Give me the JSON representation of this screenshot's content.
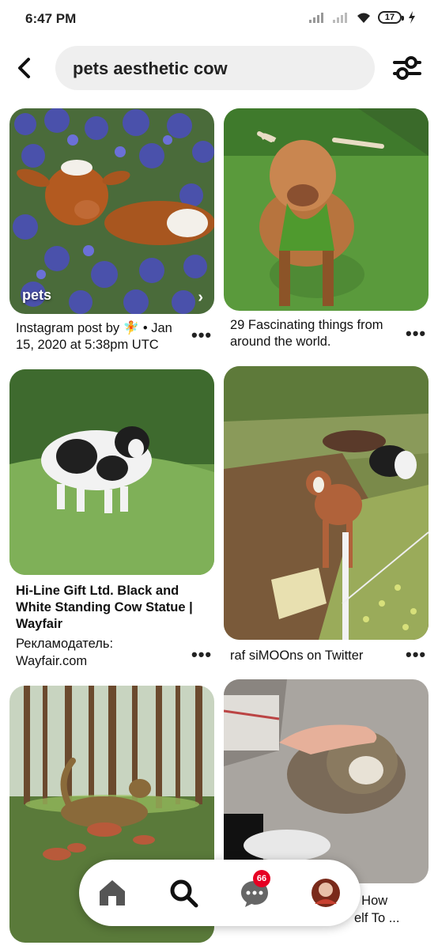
{
  "status_bar": {
    "time": "6:47 PM",
    "battery": "17"
  },
  "search": {
    "query": "pets aesthetic cow"
  },
  "pins": [
    {
      "board_label": "pets",
      "title": "Instagram post by 🧚 • Jan 15, 2020 at 5:38pm UTC"
    },
    {
      "title": "29 Fascinating things from around the world."
    },
    {
      "title": "Hi-Line Gift Ltd. Black and White Standing Cow Statue | Wayfair",
      "promoted_label": "Рекламодатель:",
      "promoted_by": "Wayfair.com"
    },
    {
      "title": "raf siMOOns on Twitter"
    },
    {
      "title": ""
    },
    {
      "title_partial": ". How",
      "title_partial_2": "elf To ..."
    }
  ],
  "nav": {
    "items": [
      "home-icon",
      "search-icon",
      "messages-icon",
      "profile-avatar"
    ],
    "notifications": "66"
  },
  "colors": {
    "accent": "#e60023",
    "search_bg": "#efefef"
  }
}
